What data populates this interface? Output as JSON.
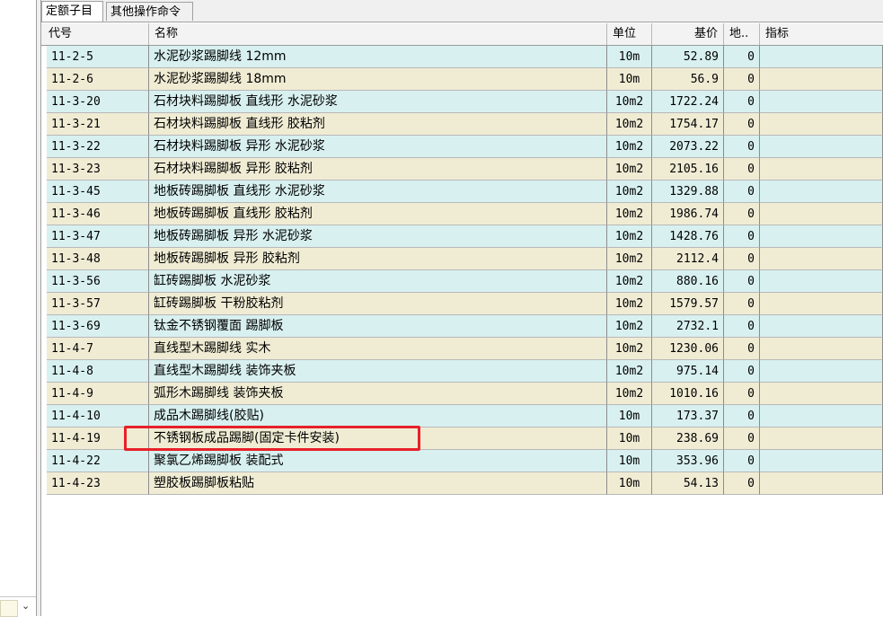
{
  "tabs": [
    {
      "label": "定额子目",
      "active": true
    },
    {
      "label": "其他操作命令",
      "active": false
    }
  ],
  "columns": [
    "代号",
    "名称",
    "单位",
    "基价",
    "地..",
    "指标"
  ],
  "rows": [
    {
      "code": "11-2-5",
      "name": "水泥砂浆踢脚线 12mm",
      "unit": "10m",
      "price": "52.89",
      "qty": "0"
    },
    {
      "code": "11-2-6",
      "name": "水泥砂浆踢脚线 18mm",
      "unit": "10m",
      "price": "56.9",
      "qty": "0"
    },
    {
      "code": "11-3-20",
      "name": "石材块料踢脚板 直线形 水泥砂浆",
      "unit": "10m2",
      "price": "1722.24",
      "qty": "0"
    },
    {
      "code": "11-3-21",
      "name": "石材块料踢脚板 直线形 胶粘剂",
      "unit": "10m2",
      "price": "1754.17",
      "qty": "0"
    },
    {
      "code": "11-3-22",
      "name": "石材块料踢脚板 异形 水泥砂浆",
      "unit": "10m2",
      "price": "2073.22",
      "qty": "0"
    },
    {
      "code": "11-3-23",
      "name": "石材块料踢脚板 异形 胶粘剂",
      "unit": "10m2",
      "price": "2105.16",
      "qty": "0"
    },
    {
      "code": "11-3-45",
      "name": "地板砖踢脚板 直线形 水泥砂浆",
      "unit": "10m2",
      "price": "1329.88",
      "qty": "0"
    },
    {
      "code": "11-3-46",
      "name": "地板砖踢脚板 直线形 胶粘剂",
      "unit": "10m2",
      "price": "1986.74",
      "qty": "0"
    },
    {
      "code": "11-3-47",
      "name": "地板砖踢脚板 异形 水泥砂浆",
      "unit": "10m2",
      "price": "1428.76",
      "qty": "0"
    },
    {
      "code": "11-3-48",
      "name": "地板砖踢脚板 异形 胶粘剂",
      "unit": "10m2",
      "price": "2112.4",
      "qty": "0"
    },
    {
      "code": "11-3-56",
      "name": "缸砖踢脚板 水泥砂浆",
      "unit": "10m2",
      "price": "880.16",
      "qty": "0"
    },
    {
      "code": "11-3-57",
      "name": "缸砖踢脚板 干粉胶粘剂",
      "unit": "10m2",
      "price": "1579.57",
      "qty": "0"
    },
    {
      "code": "11-3-69",
      "name": "钛金不锈钢覆面 踢脚板",
      "unit": "10m2",
      "price": "2732.1",
      "qty": "0"
    },
    {
      "code": "11-4-7",
      "name": "直线型木踢脚线 实木",
      "unit": "10m2",
      "price": "1230.06",
      "qty": "0"
    },
    {
      "code": "11-4-8",
      "name": "直线型木踢脚线 装饰夹板",
      "unit": "10m2",
      "price": "975.14",
      "qty": "0"
    },
    {
      "code": "11-4-9",
      "name": "弧形木踢脚线 装饰夹板",
      "unit": "10m2",
      "price": "1010.16",
      "qty": "0"
    },
    {
      "code": "11-4-10",
      "name": "成品木踢脚线(胶贴)",
      "unit": "10m",
      "price": "173.37",
      "qty": "0"
    },
    {
      "code": "11-4-19",
      "name": "不锈钢板成品踢脚(固定卡件安装)",
      "unit": "10m",
      "price": "238.69",
      "qty": "0"
    },
    {
      "code": "11-4-22",
      "name": "聚氯乙烯踢脚板 装配式",
      "unit": "10m",
      "price": "353.96",
      "qty": "0"
    },
    {
      "code": "11-4-23",
      "name": "塑胶板踢脚板粘贴",
      "unit": "10m",
      "price": "54.13",
      "qty": "0"
    }
  ],
  "highlighted_row": "11-4-19",
  "colors": {
    "row_a": "#d8f0f0",
    "row_b": "#f0ecd4",
    "highlight": "#e8202a"
  }
}
